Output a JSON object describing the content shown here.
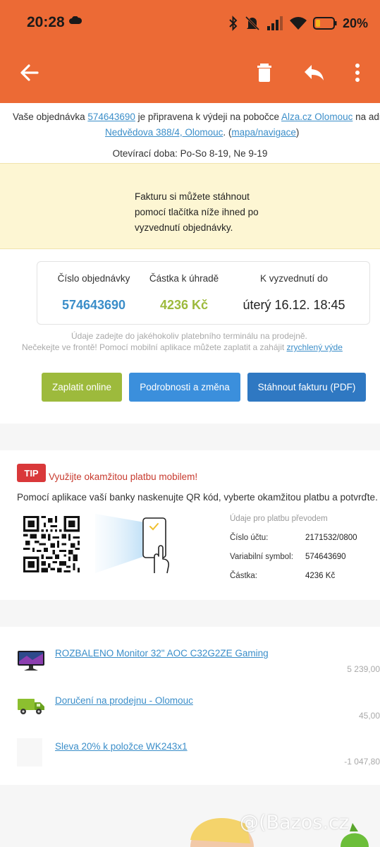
{
  "status_bar": {
    "time": "20:28",
    "battery": "20%",
    "icons": [
      "cloud-icon",
      "bluetooth-icon",
      "mute-vibrate-icon",
      "signal-icon",
      "wifi-icon",
      "battery-icon"
    ]
  },
  "toolbar": {
    "icons": [
      "back-arrow-icon",
      "trash-icon",
      "reply-icon",
      "more-vert-icon"
    ],
    "color": "#ec6a35"
  },
  "intro": {
    "pre": "Vaše objednávka ",
    "order_link": "574643690",
    "mid": " je připravena k výdeji na pobočce ",
    "branch_link": "Alza.cz Olomouc",
    "post": " na adr",
    "address_link": "Nedvědova 388/4, Olomouc",
    "sep": ".  (",
    "map_link": "mapa/navigace",
    "close": ")",
    "hours": "Otevírací doba: Po-So 8-19, Ne 9-19"
  },
  "notice": {
    "text_line1": "Fakturu si můžete stáhnout",
    "text_line2": "pomocí tlačítka níže ihned po",
    "text_line3": "vyzvednutí objednávky."
  },
  "summary": {
    "order_label": "Číslo objednávky",
    "order_value": "574643690",
    "amount_label": "Částka k úhradě",
    "amount_value": "4236 Kč",
    "pickup_label": "K vyzvednutí do",
    "pickup_value": "úterý 16.12. 18:45"
  },
  "hint": {
    "line1": "Údaje zadejte do jakéhokoliv platebního terminálu na prodejně.",
    "line2": "Nečekejte ve frontě! Pomocí mobilní aplikace můžete zaplatit a zahájit ",
    "link": "zrychlený výde"
  },
  "buttons": {
    "pay_online": "Zaplatit online",
    "details": "Podrobnosti a změna",
    "download_invoice": "Stáhnout fakturu (PDF)"
  },
  "tip": {
    "badge": "TIP",
    "title": "Využijte okamžitou platbu mobilem!",
    "description": "Pomocí aplikace vaší banky naskenujte QR kód, vyberte okamžitou platbu a potvrďte.",
    "payment_header": "Údaje pro platbu převodem",
    "account_label": "Číslo účtu:",
    "account_value": "2171532/0800",
    "vs_label": "Variabilní symbol:",
    "vs_value": "574643690",
    "amount_label": "Částka:",
    "amount_value": "4236 Kč"
  },
  "items": [
    {
      "name": "ROZBALENO Monitor 32\" AOC C32G2ZE Gaming",
      "price": "5 239,00",
      "icon": "monitor-icon"
    },
    {
      "name": "Doručení na prodejnu - Olomouc",
      "price": "45,00",
      "icon": "delivery-truck-icon"
    },
    {
      "name": "Sleva 20% k položce WK243x1",
      "price": "-1 047,80",
      "icon": "discount-placeholder"
    }
  ],
  "watermark": "@(Bazos.cz"
}
